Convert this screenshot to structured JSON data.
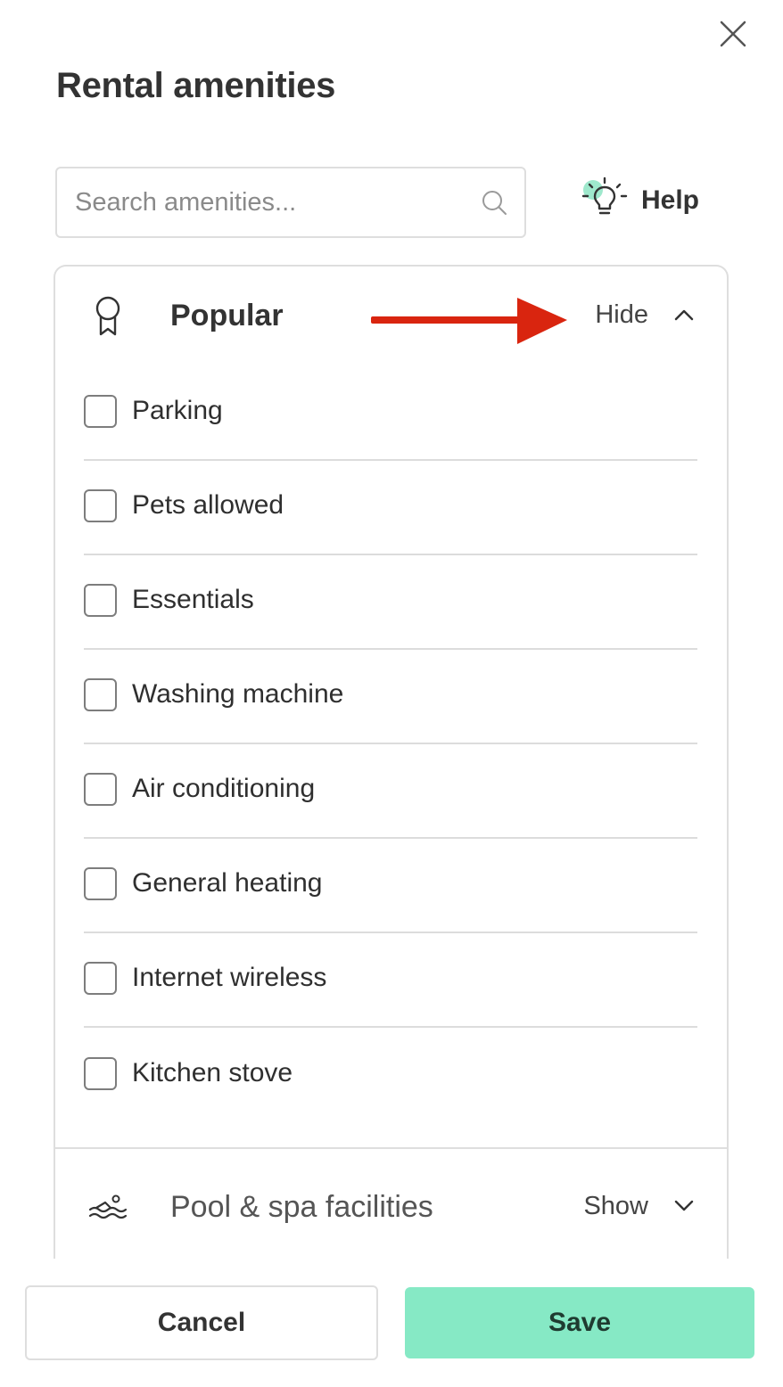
{
  "dialog": {
    "title": "Rental amenities",
    "close_icon": "close-icon"
  },
  "search": {
    "placeholder": "Search amenities...",
    "value": "",
    "icon": "search-icon"
  },
  "help": {
    "label": "Help",
    "icon": "lightbulb-icon",
    "accent_color": "#9ee8cc"
  },
  "sections": {
    "popular": {
      "title": "Popular",
      "icon": "award-ribbon-icon",
      "toggle_label": "Hide",
      "toggle_icon": "chevron-up-icon",
      "items": [
        {
          "label": "Parking",
          "checked": false
        },
        {
          "label": "Pets allowed",
          "checked": false
        },
        {
          "label": "Essentials",
          "checked": false
        },
        {
          "label": "Washing machine",
          "checked": false
        },
        {
          "label": "Air conditioning",
          "checked": false
        },
        {
          "label": "General heating",
          "checked": false
        },
        {
          "label": "Internet wireless",
          "checked": false
        },
        {
          "label": "Kitchen stove",
          "checked": false
        }
      ]
    },
    "pool": {
      "title": "Pool & spa facilities",
      "icon": "swimmer-icon",
      "toggle_label": "Show",
      "toggle_icon": "chevron-down-icon"
    }
  },
  "annotation": {
    "icon": "red-arrow-icon",
    "color": "#d9250f"
  },
  "footer": {
    "cancel_label": "Cancel",
    "save_label": "Save",
    "save_color": "#86e9c5"
  }
}
